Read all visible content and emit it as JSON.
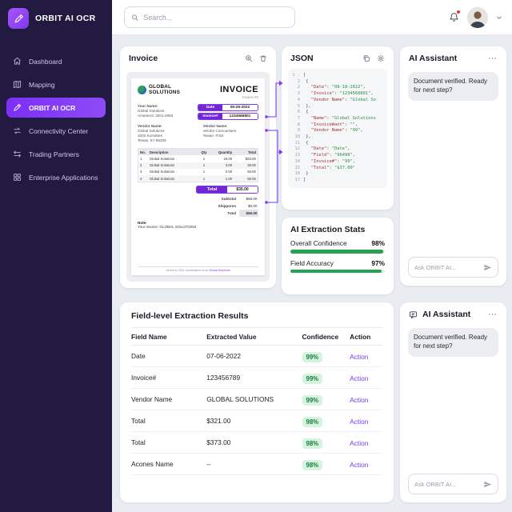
{
  "colors": {
    "accent": "#7c3aed",
    "sidebar_bg": "#221a40",
    "active_item": "#7b2ff7",
    "confidence_badge_bg": "#d5f3de",
    "confidence_badge_text": "#177d3c",
    "progress_green": "#26a250",
    "notification_dot": "#e53935"
  },
  "icons": {
    "more_glyph": "⋯",
    "gear_glyph": "⚙"
  },
  "topbar": {
    "search_placeholder": "Search..."
  },
  "sidebar": {
    "logo_title": "ORBIT AI OCR",
    "items": [
      {
        "id": "dashboard",
        "label": "Dashboard",
        "icon": "home-icon",
        "active": false
      },
      {
        "id": "mapping",
        "label": "Mapping",
        "icon": "map-icon",
        "active": false
      },
      {
        "id": "orbit-ai-ocr",
        "label": "ORBIT AI OCR",
        "icon": "pen-icon",
        "active": true
      },
      {
        "id": "connectivity-center",
        "label": "Connectivity Center",
        "icon": "connect-icon",
        "active": false
      },
      {
        "id": "trading-partners",
        "label": "Trading Partners",
        "icon": "swap-icon",
        "active": false
      },
      {
        "id": "enterprise-applications",
        "label": "Enterprise Applications",
        "icon": "grid-icon",
        "active": false
      }
    ]
  },
  "invoice_card": {
    "title": "Invoice",
    "doc": {
      "company_line1": "GLOBAL",
      "company_line2": "SOLUTIONS",
      "doc_title": "INVOICE",
      "doc_subtitle": "Invoice #2",
      "your_name_label": "Your Name:",
      "your_name": "Global Solutions",
      "your_addr": "Amanen3: 3201-2653",
      "badges": [
        {
          "label": "Date",
          "value": "05-25-2022"
        },
        {
          "label": "Invoice#",
          "value": "1234566801"
        }
      ],
      "vendor1": {
        "label": "Vendor Name:",
        "lines": [
          "Global Solutions",
          "1002 Komdoes",
          "Tewas, KY 85335"
        ]
      },
      "vendor2": {
        "label": "Vendor Name:",
        "lines": [
          "Vendor Comcarisers",
          "Tewan: FIS/t"
        ]
      },
      "table": {
        "headers": [
          "No.",
          "Description",
          "Qty",
          "Quantity",
          "Total"
        ],
        "rows": [
          [
            "1",
            "Global Solutions",
            "1",
            "19.00",
            "$20.00"
          ],
          [
            "2",
            "Global Solutions",
            "1",
            "3.00",
            "30.00"
          ],
          [
            "3",
            "Global Solutions",
            "1",
            "2.00",
            "50.00"
          ],
          [
            "4",
            "Global Solutions",
            "1",
            "1.00",
            "50.00"
          ]
        ]
      },
      "total_badge": {
        "label": "Total",
        "value": "$35.00"
      },
      "summary": [
        {
          "label": "Subtotal",
          "value": "$59.00"
        },
        {
          "label": "Shippores",
          "value": "$0.00"
        },
        {
          "label": "Total",
          "value": "$56.00"
        }
      ],
      "note_label": "Note:",
      "note": "Your invoice: GLOBAL SOLUTIONS",
      "footer": "Global to 2021 mouthaisere at an ",
      "footer_link": "Global Solutions"
    }
  },
  "json_card": {
    "title": "JSON",
    "lines": [
      {
        "g": "1 -",
        "segs": [
          [
            "pun",
            "["
          ]
        ]
      },
      {
        "g": "2",
        "segs": [
          [
            "pun",
            " {"
          ]
        ]
      },
      {
        "g": "2",
        "segs": [
          [
            "key",
            "   \"Date\""
          ],
          [
            "pun",
            ": "
          ],
          [
            "str",
            "\"08-18-2022\""
          ],
          [
            "pun",
            ","
          ]
        ]
      },
      {
        "g": "3",
        "segs": [
          [
            "key",
            "   \"Invoice\""
          ],
          [
            "pun",
            ": "
          ],
          [
            "str",
            "\"1234568891\""
          ],
          [
            "pun",
            ","
          ]
        ]
      },
      {
        "g": "4",
        "segs": [
          [
            "key",
            "   \"Vendor Name\""
          ],
          [
            "pun",
            ": "
          ],
          [
            "str",
            "\"Global So"
          ]
        ]
      },
      {
        "g": "5",
        "segs": [
          [
            "pun",
            " },"
          ]
        ]
      },
      {
        "g": "6",
        "segs": [
          [
            "pun",
            " {"
          ]
        ]
      },
      {
        "g": "7",
        "segs": [
          [
            "key",
            "   \"Name\""
          ],
          [
            "pun",
            ": "
          ],
          [
            "str",
            "\"Global Solutions"
          ]
        ]
      },
      {
        "g": "8",
        "segs": [
          [
            "key",
            "   \"InvoiceWant\""
          ],
          [
            "pun",
            ": "
          ],
          [
            "str",
            "\"\""
          ],
          [
            "pun",
            ","
          ]
        ]
      },
      {
        "g": "9",
        "segs": [
          [
            "key",
            "   \"Vendor Name\""
          ],
          [
            "pun",
            ": "
          ],
          [
            "str",
            "\"99\""
          ],
          [
            "pun",
            ","
          ]
        ]
      },
      {
        "g": "10",
        "segs": [
          [
            "pun",
            " },"
          ]
        ]
      },
      {
        "g": "11",
        "segs": [
          [
            "pun",
            " {"
          ]
        ]
      },
      {
        "g": "12",
        "segs": [
          [
            "key",
            "   \"Date\""
          ],
          [
            "pun",
            ": "
          ],
          [
            "str",
            "\"Date\""
          ],
          [
            "pun",
            ","
          ]
        ]
      },
      {
        "g": "13",
        "segs": [
          [
            "key",
            "   \"Field\""
          ],
          [
            "pun",
            ": "
          ],
          [
            "str",
            "\"96498\""
          ],
          [
            "pun",
            ","
          ]
        ]
      },
      {
        "g": "14",
        "segs": [
          [
            "key",
            "   \"Invoice#\""
          ],
          [
            "pun",
            ": "
          ],
          [
            "str",
            "\"99\""
          ],
          [
            "pun",
            ","
          ]
        ]
      },
      {
        "g": "15",
        "segs": [
          [
            "key",
            "   \"Total\""
          ],
          [
            "pun",
            ": "
          ],
          [
            "str",
            "\"$37.00\""
          ]
        ]
      },
      {
        "g": "16",
        "segs": [
          [
            "pun",
            " }"
          ]
        ]
      },
      {
        "g": "17",
        "segs": [
          [
            "pun",
            "]"
          ]
        ]
      }
    ]
  },
  "ai_assistant_top": {
    "title": "AI Assistant",
    "message": "Document verified. Ready for next step?",
    "input_placeholder": "Ask ORBIT AI..."
  },
  "ai_assistant_bottom": {
    "title": "AI Assistant",
    "message": "Document verified. Ready for next step?",
    "input_placeholder": "Ask ORBIT AI..."
  },
  "stats_card": {
    "title": "AI Extraction Stats",
    "stats": [
      {
        "label": "Overall Confidence",
        "value": "98%",
        "pct": 98
      },
      {
        "label": "Field Accuracy",
        "value": "97%",
        "pct": 97
      }
    ]
  },
  "results_card": {
    "title": "Field-level Extraction Results",
    "headers": [
      "Field Name",
      "Extracted Value",
      "Confidence",
      "Action"
    ],
    "rows": [
      {
        "field": "Date",
        "value": "07-06-2022",
        "confidence": "99%",
        "action": "Action"
      },
      {
        "field": "Invoice#",
        "value": "123456789",
        "confidence": "99%",
        "action": "Action"
      },
      {
        "field": "Vendor Name",
        "value": "GLOBAL SOLUTIONS",
        "confidence": "99%",
        "action": "Action"
      },
      {
        "field": "Total",
        "value": "$321.00",
        "confidence": "98%",
        "action": "Action"
      },
      {
        "field": "Total",
        "value": "$373.00",
        "confidence": "98%",
        "action": "Action"
      },
      {
        "field": "Acones Name",
        "value": "--",
        "confidence": "98%",
        "action": "Action"
      }
    ]
  }
}
